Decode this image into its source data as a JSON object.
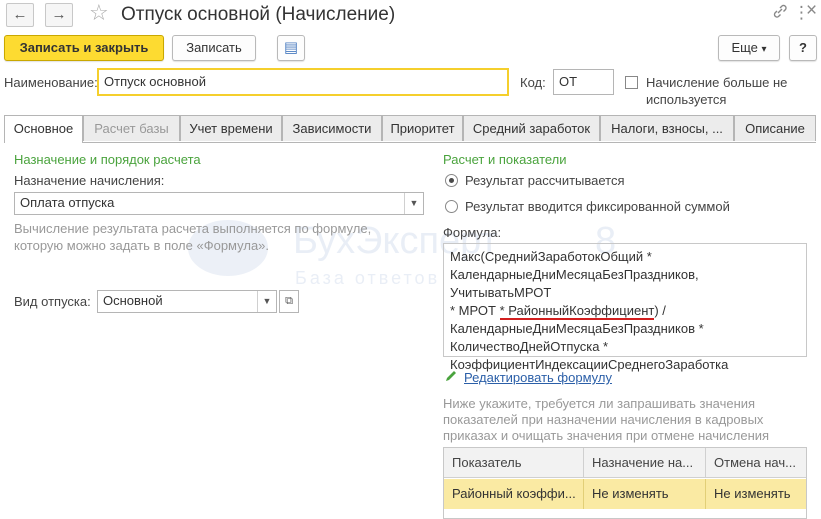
{
  "window": {
    "title": "Отпуск основной (Начисление)",
    "nav_back": "←",
    "nav_forward": "→",
    "star": "☆",
    "link_icon": "🔗",
    "menu_icon": "⋮",
    "close_icon": "×"
  },
  "toolbar": {
    "save_close_label": "Записать и закрыть",
    "save_label": "Записать",
    "doc_icon": "▤",
    "more_label": "Еще",
    "more_arrow": "▾",
    "help_label": "?"
  },
  "header": {
    "name_label": "Наименование:",
    "name_value": "Отпуск основной",
    "code_label": "Код:",
    "code_value": "ОТ",
    "unused_label_line1": "Начисление больше не",
    "unused_label_line2": "используется"
  },
  "tabs": [
    {
      "label": "Основное"
    },
    {
      "label": "Расчет базы"
    },
    {
      "label": "Учет времени"
    },
    {
      "label": "Зависимости"
    },
    {
      "label": "Приоритет"
    },
    {
      "label": "Средний заработок"
    },
    {
      "label": "Налоги, взносы, ..."
    },
    {
      "label": "Описание"
    }
  ],
  "left": {
    "section_title": "Назначение и порядок расчета",
    "purpose_label": "Назначение начисления:",
    "purpose_value": "Оплата отпуска",
    "hint_line1": "Вычисление результата расчета выполняется по формуле,",
    "hint_line2": "которую можно задать в поле «Формула».",
    "vacation_type_label": "Вид отпуска:",
    "vacation_type_value": "Основной"
  },
  "right": {
    "section_title": "Расчет и показатели",
    "radio_calculated": "Результат рассчитывается",
    "radio_fixed": "Результат вводится фиксированной суммой",
    "formula_label": "Формула:",
    "formula_line1": "Макс(СреднийЗаработокОбщий *",
    "formula_line2": "КалендарныеДниМесяцаБезПраздников, УчитыватьМРОТ",
    "formula_line3a": "* МРОТ",
    "formula_line3b": "* РайонныйКоэффициент",
    "formula_line3c": ") /",
    "formula_line4": "КалендарныеДниМесяцаБезПраздников *",
    "formula_line5": "КоличествоДнейОтпуска *",
    "formula_line6": "КоэффициентИндексацииСреднегоЗаработка",
    "edit_formula_link": "Редактировать формулу",
    "hint_line1": "Ниже укажите, требуется ли запрашивать значения",
    "hint_line2": "показателей при назначении начисления в кадровых",
    "hint_line3": "приказах и очищать значения при отмене начисления"
  },
  "indicators_table": {
    "columns": [
      "Показатель",
      "Назначение на...",
      "Отмена нач..."
    ],
    "rows": [
      [
        "Районный коэффи...",
        "Не изменять",
        "Не изменять"
      ]
    ]
  },
  "watermark": {
    "brand": "БухЭксперт",
    "digit": "8",
    "sub": "База ответов"
  },
  "colors": {
    "primary_button": "#fddb31",
    "section_green": "#4aa33d",
    "link_blue": "#2b5fa8",
    "selected_row": "#faeaa3",
    "underline_red": "#d21f1f"
  }
}
